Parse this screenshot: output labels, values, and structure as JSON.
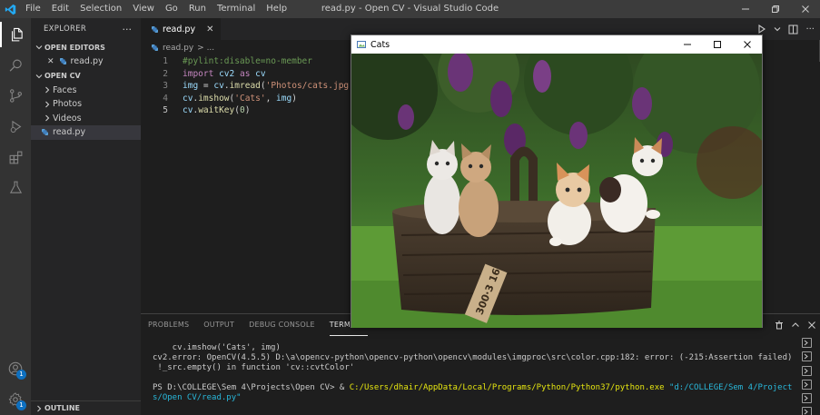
{
  "app": {
    "window_title": "read.py - Open CV - Visual Studio Code",
    "menu": [
      "File",
      "Edit",
      "Selection",
      "View",
      "Go",
      "Run",
      "Terminal",
      "Help"
    ]
  },
  "activity_bar": {
    "icons": [
      "explorer-icon",
      "search-icon",
      "source-control-icon",
      "run-debug-icon",
      "extensions-icon",
      "testing-icon",
      "account-icon",
      "settings-gear-icon"
    ],
    "account_badge": "1",
    "settings_badge": "1"
  },
  "sidebar": {
    "title": "EXPLORER",
    "more": "···",
    "open_editors": {
      "header": "OPEN EDITORS",
      "items": [
        {
          "name": "read.py",
          "close": "✕"
        }
      ]
    },
    "folder": {
      "header": "OPEN CV",
      "items": [
        {
          "name": "Faces",
          "type": "folder"
        },
        {
          "name": "Photos",
          "type": "folder"
        },
        {
          "name": "Videos",
          "type": "folder"
        },
        {
          "name": "read.py",
          "type": "python"
        }
      ]
    },
    "outline": "OUTLINE"
  },
  "editor": {
    "tab": {
      "label": "read.py",
      "close": "✕"
    },
    "breadcrumb": {
      "file": "read.py",
      "rest": "> ..."
    },
    "lines": [
      {
        "n": "1",
        "text": "#pylint:disable=no-member"
      },
      {
        "n": "2",
        "text": "import cv2 as cv"
      },
      {
        "n": "3",
        "text": "img = cv.imread('Photos/cats.jpg')"
      },
      {
        "n": "4",
        "text": "cv.imshow('Cats', img)"
      },
      {
        "n": "5",
        "text": "cv.waitKey(0)"
      }
    ],
    "colors": {
      "comment": "#6a9955",
      "keyword": "#c586c0",
      "variable": "#9cdcfe",
      "function": "#dcdcaa",
      "string": "#ce9178",
      "number": "#b5cea8",
      "text": "#d4d4d4"
    }
  },
  "panel": {
    "tabs": [
      "PROBLEMS",
      "OUTPUT",
      "DEBUG CONSOLE",
      "TERMINAL"
    ],
    "active_tab": "TERMINAL",
    "terminal_lines": [
      "    cv.imshow('Cats', img)",
      "cv2.error: OpenCV(4.5.5) D:\\a\\opencv-python\\opencv-python\\opencv\\modules\\imgproc\\src\\color.cpp:182: error: (-215:Assertion failed)",
      " !_src.empty() in function 'cv::cvtColor'",
      ""
    ],
    "prompt": {
      "ps": "PS D:\\COLLEGE\\Sem 4\\Projects\\Open CV> ",
      "amp": "& ",
      "exe": "C:/Users/dhair/AppData/Local/Programs/Python/Python37/python.exe",
      "arg1": " \"d:/COLLEGE/Sem 4/Project",
      "arg2": "s/Open CV/read.py\""
    }
  },
  "image_window": {
    "title": "Cats",
    "minimize": "minimize",
    "maximize": "maximize",
    "close": "close",
    "basket_tag": "300·3 16",
    "colors": {
      "sky": "#1e2a1a",
      "grass": "#4f8a2e",
      "basket": "#4a3a2a",
      "lilac": "#6a2e6e"
    }
  }
}
